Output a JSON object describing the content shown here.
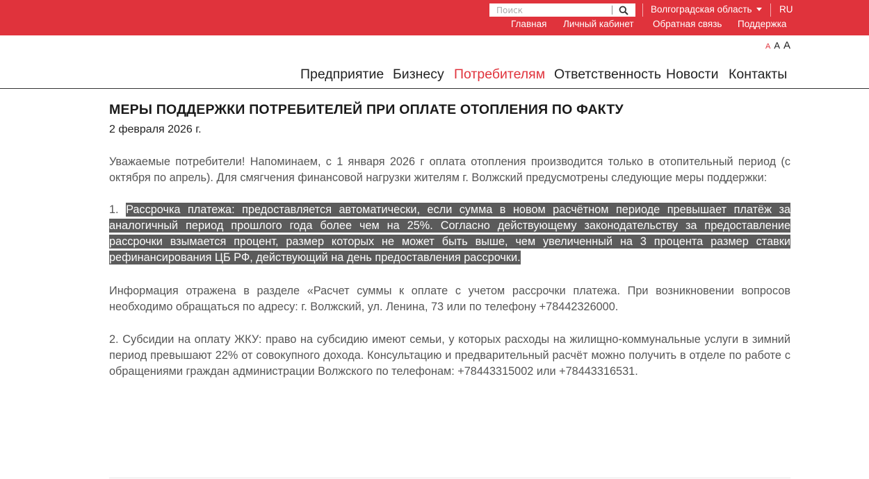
{
  "topbar": {
    "search_placeholder": "Поиск",
    "region": "Волгоградская область",
    "lang": "RU",
    "links": [
      "Главная",
      "Личный кабинет",
      "Обратная связь",
      "Поддержка"
    ]
  },
  "fontsize": {
    "small": "A",
    "medium": "A",
    "large": "A"
  },
  "nav": {
    "items": [
      "Предприятие",
      "Бизнесу",
      "Потребителям",
      "Ответственность",
      "Новости",
      "Контакты"
    ],
    "active": "Потребителям"
  },
  "article": {
    "title": "МЕРЫ ПОДДЕРЖКИ ПОТРЕБИТЕЛЕЙ ПРИ ОПЛАТЕ ОТОПЛЕНИЯ ПО ФАКТУ",
    "date": "2 февраля 2026 г.",
    "intro": "Уважаемые потребители! Напоминаем, с 1 января 2026 г оплата отопления производится только в отопительный период (с октября по апрель). Для смягчения финансовой нагрузки жителям г. Волжский предусмотрены следующие меры поддержки:",
    "item1_number": "1. ",
    "item1_text": "Рассрочка платежа: предоставляется автоматически, если сумма в новом расчётном периоде превышает платёж за аналогичный период прошлого года более чем на 25%. Согласно действующему законодательству за предоставление рассрочки взымается процент, размер которых не может быть выше, чем увеличенный на 3 процента размер ставки рефинансирования ЦБ РФ, действующий на день предоставления рассрочки.",
    "info": "Информация отражена в разделе «Расчет суммы к оплате с учетом рассрочки платежа.  При возникновении вопросов необходимо обращаться по адресу: г. Волжский, ул. Ленина, 73 или по телефону +78442326000.",
    "item2": "2. Субсидии на оплату ЖКУ: право на субсидию имеют семьи, у которых расходы на жилищно-коммунальные услуги в зимний период превышают 22% от совокупного дохода. Консультацию и предварительный расчёт можно получить в отделе по работе с обращениями граждан администрации Волжского по телефонам: +78443315002  или +78443316531."
  },
  "colors": {
    "brand_red": "#e0333c",
    "highlight": "#5b5b5b"
  },
  "icons": {
    "search": "search-icon",
    "region_caret": "chevron-down-icon"
  }
}
